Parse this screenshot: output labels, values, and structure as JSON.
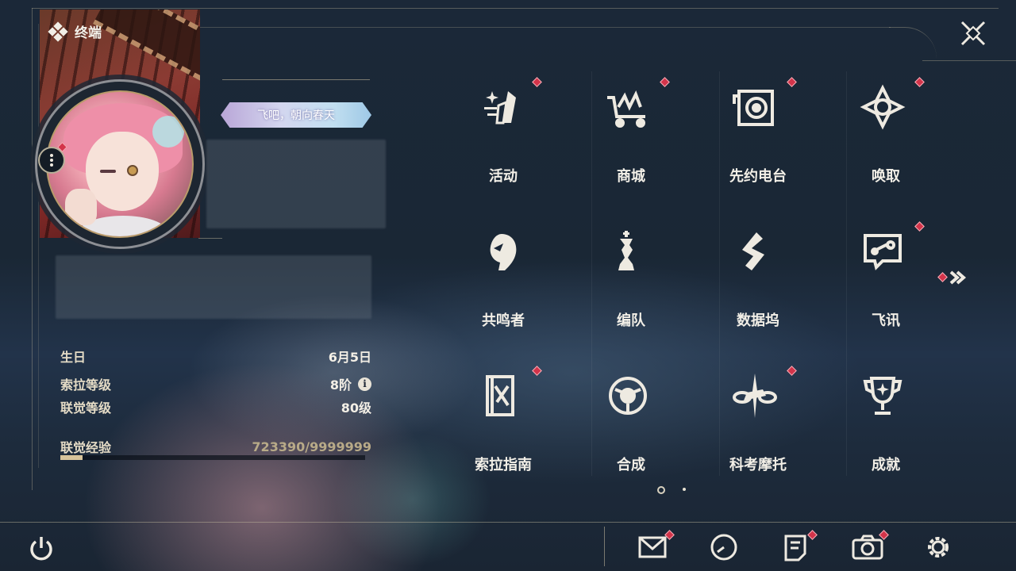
{
  "header": {
    "title": "终端"
  },
  "profile": {
    "title_badge": "飞吧，朝向春天"
  },
  "stats": {
    "birthday_label": "生日",
    "birthday_value": "6月5日",
    "sola_level_label": "索拉等级",
    "sola_level_value": "8阶",
    "union_level_label": "联觉等级",
    "union_level_value": "80级",
    "union_exp_label": "联觉经验",
    "union_exp_value": "723390/9999999",
    "union_exp_fraction": 0.0723
  },
  "menu": [
    {
      "label": "活动",
      "icon": "activity-icon",
      "badge": true
    },
    {
      "label": "商城",
      "icon": "shop-cart-icon",
      "badge": true
    },
    {
      "label": "先约电台",
      "icon": "radio-icon",
      "badge": true
    },
    {
      "label": "唤取",
      "icon": "convene-icon",
      "badge": true
    },
    {
      "label": "共鸣者",
      "icon": "resonator-icon",
      "badge": false
    },
    {
      "label": "编队",
      "icon": "team-chess-icon",
      "badge": false
    },
    {
      "label": "数据坞",
      "icon": "data-dock-icon",
      "badge": false
    },
    {
      "label": "飞讯",
      "icon": "message-icon",
      "badge": true
    },
    {
      "label": "索拉指南",
      "icon": "guide-book-icon",
      "badge": true
    },
    {
      "label": "合成",
      "icon": "synthesis-icon",
      "badge": false
    },
    {
      "label": "科考摩托",
      "icon": "motorbike-icon",
      "badge": true
    },
    {
      "label": "成就",
      "icon": "trophy-icon",
      "badge": false
    }
  ],
  "colors": {
    "badge": "#d3344a",
    "accent": "#d8c49a",
    "background": "#152231"
  },
  "bottom_bar": [
    {
      "name": "mail-icon",
      "badge": true
    },
    {
      "name": "clock-icon",
      "badge": false
    },
    {
      "name": "notes-icon",
      "badge": true
    },
    {
      "name": "camera-icon",
      "badge": true
    },
    {
      "name": "settings-gear-icon",
      "badge": false
    }
  ],
  "pagination": {
    "current": 1,
    "total": 2
  }
}
